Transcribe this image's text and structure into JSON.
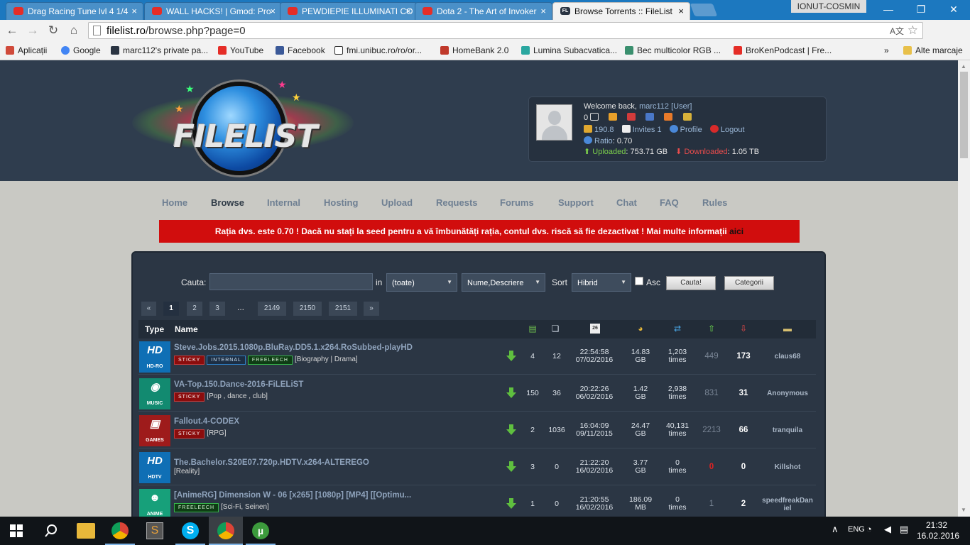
{
  "browser": {
    "tabs": [
      {
        "title": "Drag Racing Tune lvl 4 1/4",
        "icon": "youtube-icon"
      },
      {
        "title": "WALL HACKS! | Gmod: Pro",
        "icon": "youtube-icon"
      },
      {
        "title": "PEWDIEPIE ILLUMINATI CO",
        "icon": "youtube-icon"
      },
      {
        "title": "Dota 2 - The Art of Invoker",
        "icon": "youtube-icon"
      },
      {
        "title": "Browse Torrents :: FileList",
        "icon": "filelist-icon"
      }
    ],
    "profile_name": "IONUT-COSMIN",
    "url_host": "filelist.ro",
    "url_path": "/browse.php?page=0",
    "bookmarks": [
      {
        "label": "Aplicații",
        "icon": "apps-icon",
        "color": "#d04a3a"
      },
      {
        "label": "Google",
        "icon": "google-icon",
        "color": "#4285f4"
      },
      {
        "label": "marc112's private pa...",
        "icon": "filelist-icon",
        "color": "#2a3442"
      },
      {
        "label": "YouTube",
        "icon": "youtube-icon",
        "color": "#e52d27"
      },
      {
        "label": "Facebook",
        "icon": "facebook-icon",
        "color": "#3b5998"
      },
      {
        "label": "fmi.unibuc.ro/ro/or...",
        "icon": "page-icon",
        "color": "#333333"
      },
      {
        "label": "HomeBank 2.0",
        "icon": "homebank-icon",
        "color": "#c0392b"
      },
      {
        "label": "Lumina Subacvatica...",
        "icon": "s-icon",
        "color": "#2aa7a0"
      },
      {
        "label": "Bec multicolor RGB ...",
        "icon": "shop-icon",
        "color": "#3a8f6e"
      },
      {
        "label": "BroKenPodcast | Fre...",
        "icon": "youtube-icon",
        "color": "#e52d27"
      }
    ],
    "bookmarks_more": "»",
    "other_bookmarks": "Alte marcaje"
  },
  "userbox": {
    "welcome": "Welcome back,",
    "username": "marc112",
    "role": "[User]",
    "messages": "0",
    "bonus": "190.8",
    "invites": "Invites 1",
    "profile": "Profile",
    "logout": "Logout",
    "ratio_label": "Ratio",
    "ratio_value": "0.70",
    "uploaded_label": "Uploaded",
    "uploaded_value": "753.71 GB",
    "downloaded_label": "Downloaded",
    "downloaded_value": "1.05 TB"
  },
  "nav": [
    "Home",
    "Browse",
    "Internal",
    "Hosting",
    "Upload",
    "Requests",
    "Forums",
    "Support",
    "Chat",
    "FAQ",
    "Rules"
  ],
  "warning": {
    "text": "Rația dvs. este 0.70 ! Dacă nu stați la seed pentru a vă îmbunătăți rația, contul dvs. riscă să fie dezactivat ! Mai multe informații",
    "link": "aici"
  },
  "search": {
    "label": "Cauta:",
    "in_label": "in",
    "category": "(toate)",
    "field": "Nume,Descriere",
    "sort_label": "Sort",
    "sort": "Hibrid",
    "asc_label": "Asc",
    "submit": "Cauta!",
    "categories": "Categorii"
  },
  "pagination": [
    "«",
    "1",
    "2",
    "3",
    "...",
    "2149",
    "2150",
    "2151",
    "»"
  ],
  "table": {
    "col_type": "Type",
    "col_name": "Name",
    "rows": [
      {
        "cat_big": "HD",
        "cat_label": "HD-RO",
        "cat_color": "#0f6fb5",
        "name": "Steve.Jobs.2015.1080p.BluRay.DD5.1.x264.RoSubbed-playHD",
        "tags": [
          "STICKY",
          "INTERNAL",
          "FREELEECH"
        ],
        "genre": "[Biography | Drama]",
        "files": "4",
        "comments": "12",
        "time": "22:54:58",
        "date": "07/02/2016",
        "size": "14.83",
        "unit": "GB",
        "snatched": "1,203",
        "times": "times",
        "seeders": "449",
        "leechers": "173",
        "uploader": "claus68"
      },
      {
        "cat_big": "◉",
        "cat_label": "MUSIC",
        "cat_color": "#128a70",
        "name": "VA-Top.150.Dance-2016-FiLELiST",
        "tags": [
          "STICKY"
        ],
        "genre": "[Pop , dance , club]",
        "files": "150",
        "comments": "36",
        "time": "20:22:26",
        "date": "06/02/2016",
        "size": "1.42",
        "unit": "GB",
        "snatched": "2,938",
        "times": "times",
        "seeders": "831",
        "leechers": "31",
        "uploader": "Anonymous"
      },
      {
        "cat_big": "▣",
        "cat_label": "GAMES",
        "cat_color": "#9e1b1b",
        "name": "Fallout.4-CODEX",
        "tags": [
          "STICKY"
        ],
        "genre": "[RPG]",
        "files": "2",
        "comments": "1036",
        "time": "16:04:09",
        "date": "09/11/2015",
        "size": "24.47",
        "unit": "GB",
        "snatched": "40,131",
        "times": "times",
        "seeders": "2213",
        "leechers": "66",
        "uploader": "tranquila"
      },
      {
        "cat_big": "HD",
        "cat_label": "HDTV",
        "cat_color": "#0f6fb5",
        "name": "The.Bachelor.S20E07.720p.HDTV.x264-ALTEREGO",
        "tags": [],
        "genre": "[Reality]",
        "files": "3",
        "comments": "0",
        "time": "21:22:20",
        "date": "16/02/2016",
        "size": "3.77",
        "unit": "GB",
        "snatched": "0",
        "times": "times",
        "seeders": "0",
        "leechers": "0",
        "uploader": "Killshot"
      },
      {
        "cat_big": "☻",
        "cat_label": "ANIME",
        "cat_color": "#17a07a",
        "name": "[AnimeRG] Dimension W - 06 [x265] [1080p] [MP4] [[Optimu...",
        "tags": [
          "FREELEECH"
        ],
        "genre": "[Sci-Fi, Seinen]",
        "files": "1",
        "comments": "0",
        "time": "21:20:55",
        "date": "16/02/2016",
        "size": "186.09",
        "unit": "MB",
        "snatched": "0",
        "times": "times",
        "seeders": "1",
        "leechers": "2",
        "uploader": "speedfreakDan iel"
      }
    ]
  },
  "taskbar": {
    "time": "21:32",
    "date": "16.02.2016"
  }
}
